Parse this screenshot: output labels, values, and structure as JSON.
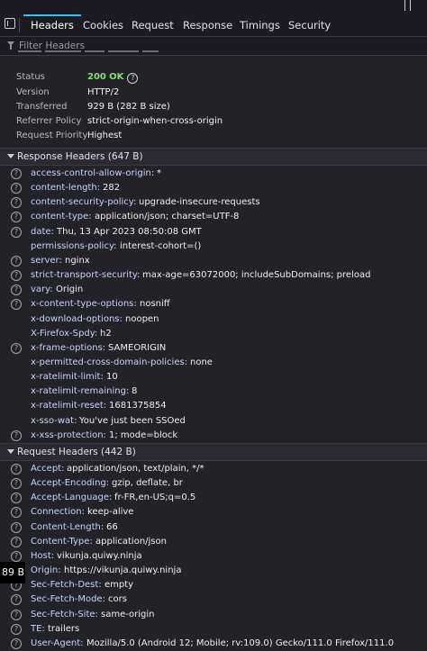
{
  "tabs": [
    "Headers",
    "Cookies",
    "Request",
    "Response",
    "Timings",
    "Security"
  ],
  "filter": {
    "placeholder": "Filter Headers"
  },
  "status_section": {
    "status_label": "Status",
    "status_code": "200",
    "status_text": "OK",
    "rows": [
      {
        "label": "Version",
        "value": "HTTP/2"
      },
      {
        "label": "Transferred",
        "value": "929 B (282 B size)"
      },
      {
        "label": "Referrer Policy",
        "value": "strict-origin-when-cross-origin"
      },
      {
        "label": "Request Priority",
        "value": "Highest"
      }
    ]
  },
  "response_headers": {
    "title": "Response Headers (647 B)",
    "items": [
      {
        "name": "access-control-allow-origin:",
        "value": "*",
        "help": true
      },
      {
        "name": "content-length:",
        "value": "282",
        "help": true
      },
      {
        "name": "content-security-policy:",
        "value": "upgrade-insecure-requests",
        "help": true
      },
      {
        "name": "content-type:",
        "value": "application/json; charset=UTF-8",
        "help": true
      },
      {
        "name": "date:",
        "value": "Thu, 13 Apr 2023 08:50:08 GMT",
        "help": true
      },
      {
        "name": "permissions-policy:",
        "value": "interest-cohort=()",
        "help": false
      },
      {
        "name": "server:",
        "value": "nginx",
        "help": true
      },
      {
        "name": "strict-transport-security:",
        "value": "max-age=63072000; includeSubDomains; preload",
        "help": true
      },
      {
        "name": "vary:",
        "value": "Origin",
        "help": true
      },
      {
        "name": "x-content-type-options:",
        "value": "nosniff",
        "help": true
      },
      {
        "name": "x-download-options:",
        "value": "noopen",
        "help": false
      },
      {
        "name": "X-Firefox-Spdy:",
        "value": "h2",
        "help": false
      },
      {
        "name": "x-frame-options:",
        "value": "SAMEORIGIN",
        "help": true
      },
      {
        "name": "x-permitted-cross-domain-policies:",
        "value": "none",
        "help": false
      },
      {
        "name": "x-ratelimit-limit:",
        "value": "10",
        "help": false
      },
      {
        "name": "x-ratelimit-remaining:",
        "value": "8",
        "help": false
      },
      {
        "name": "x-ratelimit-reset:",
        "value": "1681375854",
        "help": false
      },
      {
        "name": "x-sso-wat:",
        "value": "You've just been SSOed",
        "help": false
      },
      {
        "name": "x-xss-protection:",
        "value": "1; mode=block",
        "help": true
      }
    ]
  },
  "request_headers": {
    "title": "Request Headers (442 B)",
    "items": [
      {
        "name": "Accept:",
        "value": "application/json, text/plain, */*",
        "help": true
      },
      {
        "name": "Accept-Encoding:",
        "value": "gzip, deflate, br",
        "help": true
      },
      {
        "name": "Accept-Language:",
        "value": "fr-FR,en-US;q=0.5",
        "help": true
      },
      {
        "name": "Connection:",
        "value": "keep-alive",
        "help": true
      },
      {
        "name": "Content-Length:",
        "value": "66",
        "help": true
      },
      {
        "name": "Content-Type:",
        "value": "application/json",
        "help": true
      },
      {
        "name": "Host:",
        "value": "vikunja.quiwy.ninja",
        "help": true
      },
      {
        "name": "Origin:",
        "value": "https://vikunja.quiwy.ninja",
        "help": true
      },
      {
        "name": "Sec-Fetch-Dest:",
        "value": "empty",
        "help": true
      },
      {
        "name": "Sec-Fetch-Mode:",
        "value": "cors",
        "help": true
      },
      {
        "name": "Sec-Fetch-Site:",
        "value": "same-origin",
        "help": true
      },
      {
        "name": "TE:",
        "value": "trailers",
        "help": true
      },
      {
        "name": "User-Agent:",
        "value": "Mozilla/5.0 (Android 12; Mobile; rv:109.0) Gecko/111.0 Firefox/111.0",
        "help": true
      }
    ]
  },
  "tooltip": {
    "text": "89 B"
  },
  "colors": {
    "accent": "#2ac3ff",
    "status_ok": "#86de74",
    "header_name": "#c6d3ff",
    "background": "#232327"
  }
}
